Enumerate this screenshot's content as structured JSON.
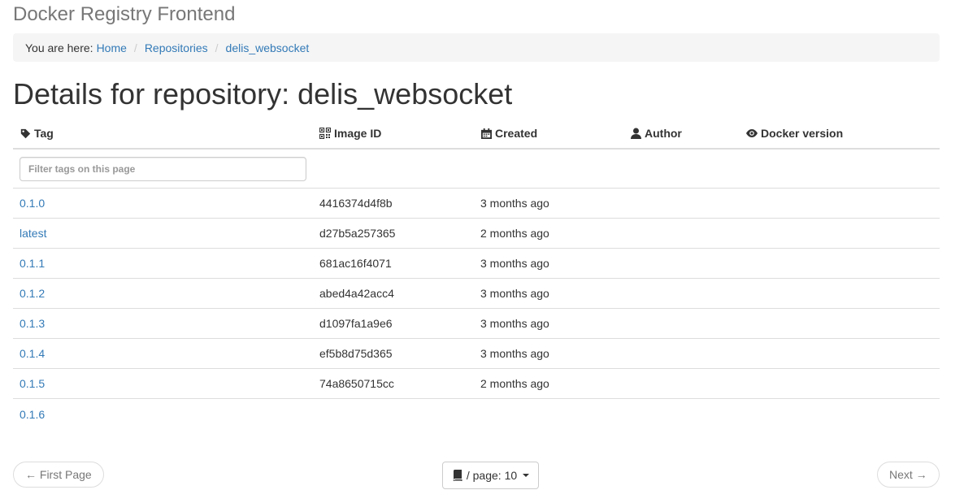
{
  "app": {
    "title": "Docker Registry Frontend"
  },
  "breadcrumb": {
    "prefix": "You are here:",
    "items": [
      "Home",
      "Repositories",
      "delis_websocket"
    ],
    "separator": "/"
  },
  "page": {
    "title": "Details for repository: delis_websocket"
  },
  "table": {
    "headers": {
      "tag": "Tag",
      "image_id": "Image ID",
      "created": "Created",
      "author": "Author",
      "docker_version": "Docker version"
    },
    "header_icons": [
      "tag-icon",
      "qrcode-icon",
      "calendar-icon",
      "user-icon",
      "eye-icon"
    ],
    "filter_placeholder": "Filter tags on this page",
    "rows": [
      {
        "tag": "0.1.0",
        "image_id": "4416374d4f8b",
        "created": "3 months ago",
        "author": "",
        "docker_version": ""
      },
      {
        "tag": "latest",
        "image_id": "d27b5a257365",
        "created": "2 months ago",
        "author": "",
        "docker_version": ""
      },
      {
        "tag": "0.1.1",
        "image_id": "681ac16f4071",
        "created": "3 months ago",
        "author": "",
        "docker_version": ""
      },
      {
        "tag": "0.1.2",
        "image_id": "abed4a42acc4",
        "created": "3 months ago",
        "author": "",
        "docker_version": ""
      },
      {
        "tag": "0.1.3",
        "image_id": "d1097fa1a9e6",
        "created": "3 months ago",
        "author": "",
        "docker_version": ""
      },
      {
        "tag": "0.1.4",
        "image_id": "ef5b8d75d365",
        "created": "3 months ago",
        "author": "",
        "docker_version": ""
      },
      {
        "tag": "0.1.5",
        "image_id": "74a8650715cc",
        "created": "2 months ago",
        "author": "",
        "docker_version": ""
      },
      {
        "tag": "0.1.6",
        "image_id": "",
        "created": "",
        "author": "",
        "docker_version": ""
      }
    ]
  },
  "pager": {
    "first_label": "← First Page",
    "per_page_label": "/ page: 10",
    "next_label": "Next →"
  },
  "colors": {
    "link": "#337ab7",
    "muted": "#777777",
    "border": "#dddddd",
    "breadcrumb_bg": "#f5f5f5"
  }
}
